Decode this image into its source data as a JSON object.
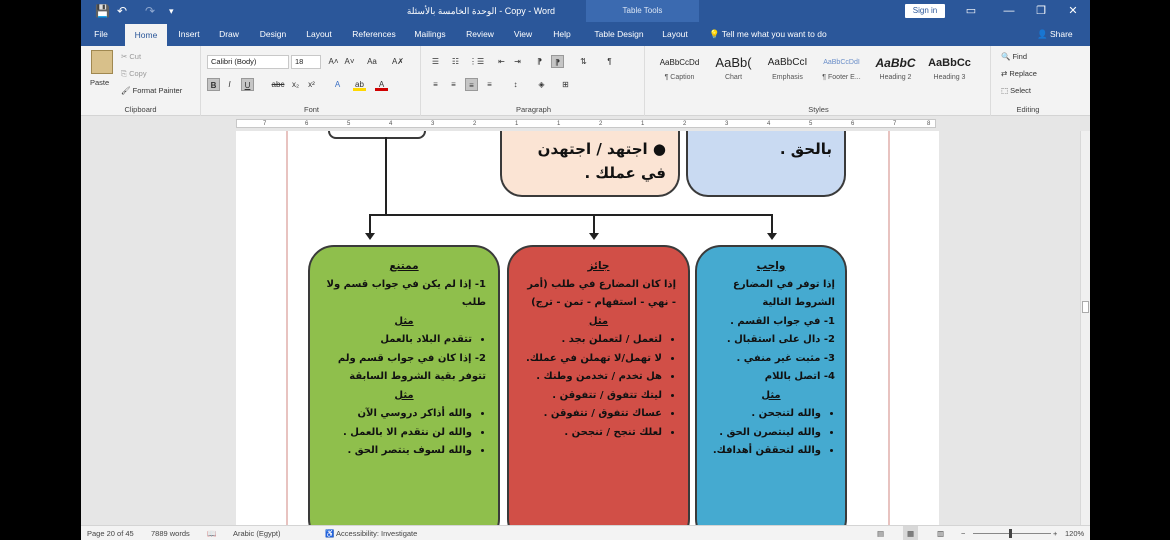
{
  "titlebar": {
    "doc_title": "الوحدة الخامسة بالأسئلة - Copy - Word",
    "context_label": "Table Tools",
    "signin": "Sign in",
    "save_glyph": "💾",
    "undo_glyph": "↶",
    "redo_glyph": "↷",
    "qat_glyph": "▾",
    "ribbon_display_glyph": "▭",
    "minimize_glyph": "—",
    "restore_glyph": "❐",
    "close_glyph": "✕"
  },
  "tabs": [
    "File",
    "Home",
    "Insert",
    "Draw",
    "Design",
    "Layout",
    "References",
    "Mailings",
    "Review",
    "View",
    "Help",
    "Table Design",
    "Layout"
  ],
  "active_tab": "Home",
  "tell_me": "Tell me what you want to do",
  "share": "Share",
  "ribbon": {
    "clipboard": {
      "paste": "Paste",
      "cut": "Cut",
      "copy": "Copy",
      "format_painter": "Format Painter",
      "label": "Clipboard"
    },
    "font": {
      "name": "Calibri (Body)",
      "size": "18",
      "label": "Font",
      "grow": "A˄",
      "shrink": "A˅",
      "case": "Aa",
      "clear": "A✗",
      "bold": "B",
      "italic": "I",
      "underline": "U",
      "strike": "abc",
      "sub": "x₂",
      "sup": "x²",
      "effects": "A",
      "highlight": "ab",
      "color": "A"
    },
    "paragraph": {
      "label": "Paragraph",
      "bullets": "☰",
      "numbering": "☷",
      "multilevel": "⋮☰",
      "dec_indent": "⇤",
      "inc_indent": "⇥",
      "ltr": "⁋",
      "rtl": "⁋",
      "sort": "⇅",
      "pilcrow": "¶",
      "align_left": "≡",
      "align_center": "≡",
      "align_right": "≡",
      "justify": "≡",
      "line_spacing": "↕",
      "shading": "◈",
      "borders": "⊞"
    },
    "styles": {
      "label": "Styles",
      "items": [
        {
          "sample": "AaBbCcDd",
          "name": "¶ Caption"
        },
        {
          "sample": "AaBb(",
          "name": "Chart"
        },
        {
          "sample": "AaBbCcI",
          "name": "Emphasis"
        },
        {
          "sample": "AaBbCcDdI",
          "name": "¶ Footer E..."
        },
        {
          "sample": "AaBbC",
          "name": "Heading 2"
        },
        {
          "sample": "AaBbCc",
          "name": "Heading 3"
        }
      ]
    },
    "editing": {
      "label": "Editing",
      "find": "Find",
      "replace": "Replace",
      "select": "Select"
    }
  },
  "ruler_numbers": [
    "7",
    "6",
    "5",
    "4",
    "3",
    "2",
    "1",
    "1",
    "2",
    "1",
    "2",
    "3",
    "4",
    "5",
    "6",
    "7",
    "8"
  ],
  "top_cards": {
    "middle": "اجتهد / اجتهدن في عملك .",
    "right": "بالحق ."
  },
  "cards": {
    "wajib": {
      "title": "واجب",
      "intro": "إذا توفر في المضارع الشروط التالية",
      "conditions": [
        "1- في جواب القسم .",
        "2- دال على استقبال .",
        "3- مثبت غير منفي .",
        "4- اتصل باللام"
      ],
      "example_label": "مثل",
      "examples": [
        "والله لتنجحن .",
        "والله لينتصرن الحق .",
        "والله لتحققن أهدافك."
      ],
      "color": "#45aad0"
    },
    "jaiz": {
      "title": "جائز",
      "intro": "إذا كان المضارع في طلب (أمر - نهي - استفهام - تمن - ترج)",
      "example_label": "مثل",
      "examples": [
        "لتعمل / لتعملن بجد .",
        "لا تهمل/لا تهملن في عملك.",
        "هل تخدم / تخدمن وطنك .",
        "ليتك تتفوق / تتفوقن .",
        "عساك تتفوق / تتفوقن .",
        "لعلك تنجح / تنجحن ."
      ],
      "color": "#d14f47"
    },
    "mumtani": {
      "title": "ممتنع",
      "cond1": "1- إذا لم يكن في جواب قسم ولا طلب",
      "example_label": "مثل",
      "examples1": [
        "تتقدم البلاد بالعمل"
      ],
      "cond2": "2- إذا كان في جواب قسم ولم تتوفر بقية الشروط السابقة",
      "examples2": [
        "والله أذاكر دروسي الآن",
        "والله لن نتقدم الا بالعمل .",
        "والله لسوف ينتصر الحق ."
      ],
      "color": "#8fbf4c"
    }
  },
  "statusbar": {
    "page": "Page 20 of 45",
    "words": "7889 words",
    "language": "Arabic (Egypt)",
    "accessibility": "Accessibility: Investigate",
    "zoom": "120%"
  }
}
